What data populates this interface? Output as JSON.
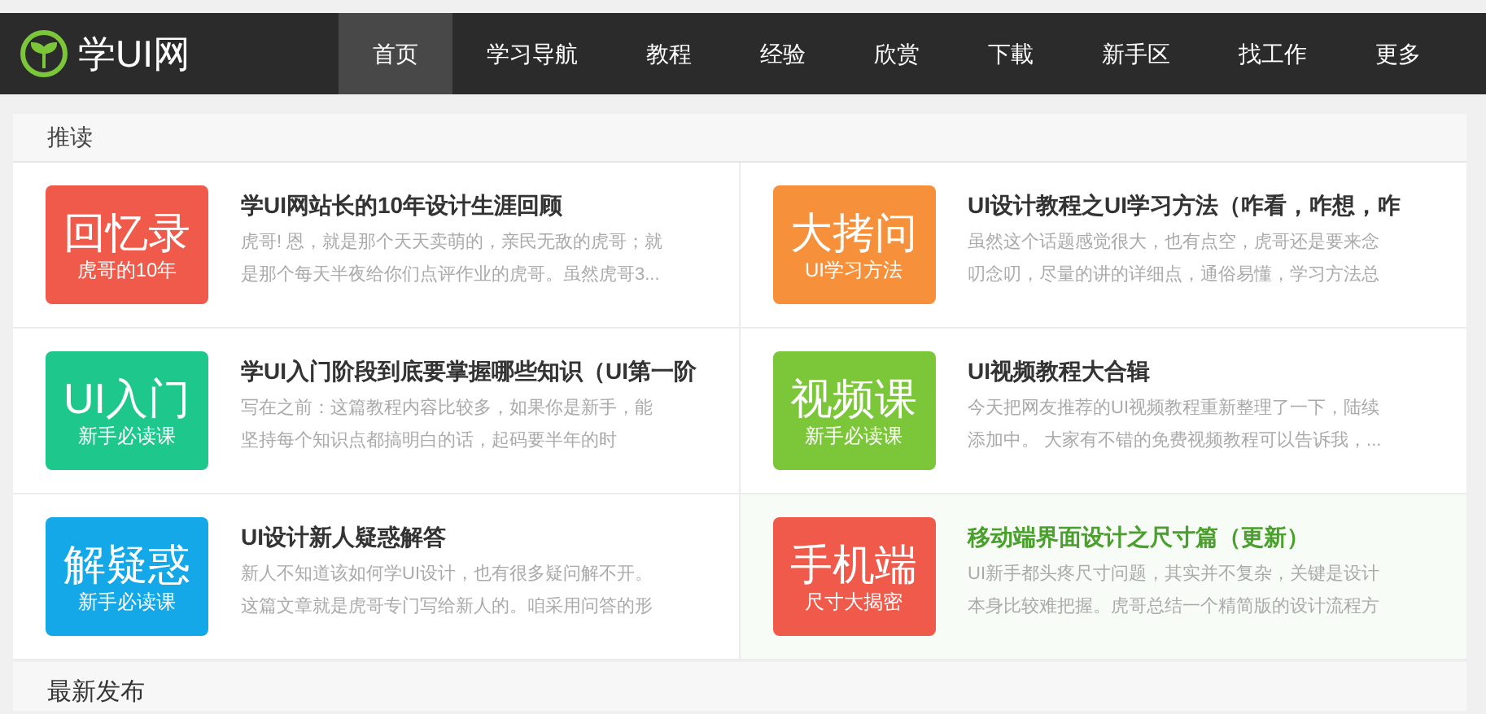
{
  "logo": {
    "text": "学UI网"
  },
  "nav": [
    {
      "label": "首页",
      "selected": true
    },
    {
      "label": "学习导航",
      "selected": false
    },
    {
      "label": "教程",
      "selected": false
    },
    {
      "label": "经验",
      "selected": false
    },
    {
      "label": "欣赏",
      "selected": false
    },
    {
      "label": "下載",
      "selected": false
    },
    {
      "label": "新手区",
      "selected": false
    },
    {
      "label": "找工作",
      "selected": false
    },
    {
      "label": "更多",
      "selected": false
    }
  ],
  "featured": {
    "heading": "推读",
    "items": [
      {
        "thumb_title": "回忆录",
        "thumb_subtitle": "虎哥的10年",
        "color": "#f05a4a",
        "title": "学UI网站长的10年设计生涯回顾",
        "desc_lines": [
          "虎哥! 恩，就是那个天天卖萌的，亲民无敌的虎哥；就",
          "是那个每天半夜给你们点评作业的虎哥。虽然虎哥3..."
        ],
        "selected": false
      },
      {
        "thumb_title": "大拷问",
        "thumb_subtitle": "UI学习方法",
        "color": "#f7903a",
        "title": "UI设计教程之UI学习方法（咋看，咋想，咋",
        "desc_lines": [
          "虽然这个话题感觉很大，也有点空，虎哥还是要来念",
          "叨念叨，尽量的讲的详细点，通俗易懂，学习方法总"
        ],
        "selected": false
      },
      {
        "thumb_title": "UI入门",
        "thumb_subtitle": "新手必读课",
        "color": "#1ec88c",
        "title": "学UI入门阶段到底要掌握哪些知识（UI第一阶",
        "desc_lines": [
          "写在之前：这篇教程内容比较多，如果你是新手，能",
          "坚持每个知识点都搞明白的话，起码要半年的时"
        ],
        "selected": false
      },
      {
        "thumb_title": "视频课",
        "thumb_subtitle": "新手必读课",
        "color": "#7cc63a",
        "title": "UI视频教程大合辑",
        "desc_lines": [
          "今天把网友推荐的UI视频教程重新整理了一下，陆续",
          "添加中。 大家有不错的免费视频教程可以告诉我，..."
        ],
        "selected": false
      },
      {
        "thumb_title": "解疑惑",
        "thumb_subtitle": "新手必读课",
        "color": "#14a8e8",
        "title": "UI设计新人疑惑解答",
        "desc_lines": [
          "新人不知道该如何学UI设计，也有很多疑问解不开。",
          "这篇文章就是虎哥专门写给新人的。咱采用问答的形"
        ],
        "selected": false
      },
      {
        "thumb_title": "手机端",
        "thumb_subtitle": "尺寸大揭密",
        "color": "#f05a4a",
        "title": "移动端界面设计之尺寸篇（更新）",
        "desc_lines": [
          "UI新手都头疼尺寸问题，其实并不复杂，关键是设计",
          "本身比较难把握。虎哥总结一个精简版的设计流程方"
        ],
        "selected": true
      }
    ]
  },
  "latest": {
    "heading": "最新发布"
  }
}
